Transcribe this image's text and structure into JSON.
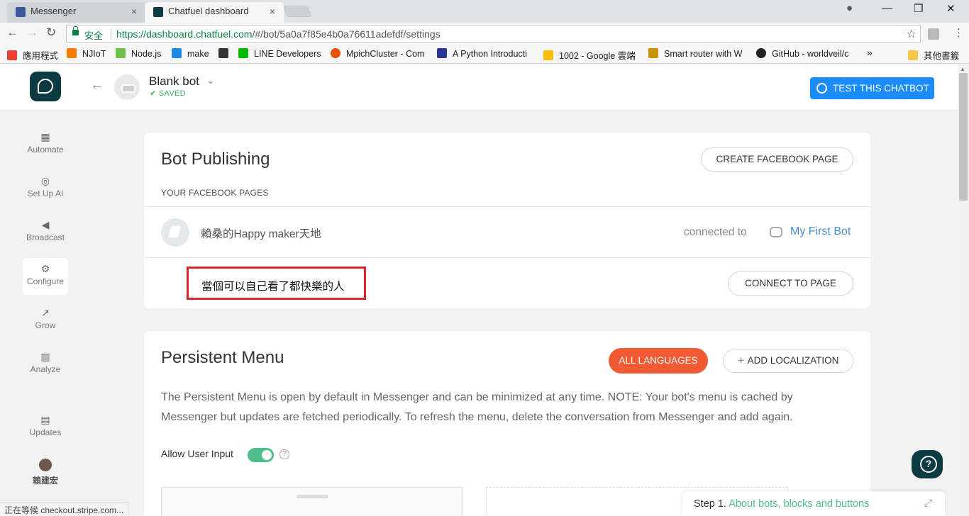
{
  "browser": {
    "tabs": [
      {
        "label": "Messenger",
        "close": "×"
      },
      {
        "label": "Chatfuel dashboard",
        "close": "×"
      }
    ],
    "window_controls": {
      "account": "●",
      "minimize": "—",
      "restore": "❐",
      "close": "✕"
    },
    "nav": {
      "back": "←",
      "forward": "→",
      "reload": "↻"
    },
    "secure_label": "安全",
    "url_host": "https://dashboard.chatfuel.com",
    "url_path": "/#/bot/5a0a7f85e4b0a76611adefdf/settings",
    "star": "☆",
    "menu": "⋮",
    "bookmarks": [
      {
        "label": "應用程式",
        "color": "#e94235"
      },
      {
        "label": "NJIoT",
        "color": "#f57c00"
      },
      {
        "label": "Node.js",
        "color": "#6cc24a"
      },
      {
        "label": "make",
        "color": "#1e88e5"
      },
      {
        "label": "",
        "color": "#333333"
      },
      {
        "label": "LINE Developers",
        "color": "#00b900"
      },
      {
        "label": "MpichCluster - Com",
        "color": "#e65100"
      },
      {
        "label": "A Python Introducti",
        "color": "#283593"
      },
      {
        "label": "1002 - Google 雲端",
        "color": "#fbbc04"
      },
      {
        "label": "Smart router with W",
        "color": "#c79100"
      },
      {
        "label": "GitHub - worldveil/c",
        "color": "#222222"
      }
    ],
    "bookmarks_more": "»",
    "other_bookmarks": "其他書籤",
    "status_text": "正在等候 checkout.stripe.com..."
  },
  "header": {
    "back_arrow": "←",
    "bot_name": "Blank bot",
    "dropdown": "⌄",
    "saved": "✔ SAVED",
    "test_button": "TEST THIS CHATBOT"
  },
  "sidebar": {
    "items": [
      {
        "label": "Automate",
        "icon": "▦"
      },
      {
        "label": "Set Up AI",
        "icon": "◎"
      },
      {
        "label": "Broadcast",
        "icon": "◀"
      },
      {
        "label": "Configure",
        "icon": "⚙"
      },
      {
        "label": "Grow",
        "icon": "↗"
      },
      {
        "label": "Analyze",
        "icon": "▥"
      },
      {
        "label": "Updates",
        "icon": "▤"
      },
      {
        "label": "賴建宏",
        "icon": ""
      }
    ]
  },
  "publishing": {
    "title": "Bot Publishing",
    "create_button": "CREATE FACEBOOK PAGE",
    "subheading": "YOUR FACEBOOK PAGES",
    "page1_name": "賴桑的Happy maker天地",
    "connected_to": "connected to",
    "bot_link": "My First Bot",
    "page2_name": "當個可以自己看了都快樂的人",
    "connect_button": "CONNECT TO PAGE"
  },
  "persistent_menu": {
    "title": "Persistent Menu",
    "all_languages": "ALL LANGUAGES",
    "add_localization": "ADD LOCALIZATION",
    "plus": "+",
    "description": "The Persistent Menu is open by default in Messenger and can be minimized at any time. NOTE: Your bot's menu is cached by Messenger but updates are fetched periodically. To refresh the menu, delete the conversation from Messenger and add again.",
    "allow_user_input": "Allow User Input",
    "toggle_on": true,
    "help": "?"
  },
  "step_panel": {
    "step": "Step 1.",
    "link": "About bots, blocks and buttons",
    "expand": "⤢"
  },
  "colors": {
    "brand": "#0d3b44",
    "primary": "#1a8cff",
    "accent": "#f05b33",
    "success": "#4dbd89",
    "highlight": "#e0212b"
  }
}
